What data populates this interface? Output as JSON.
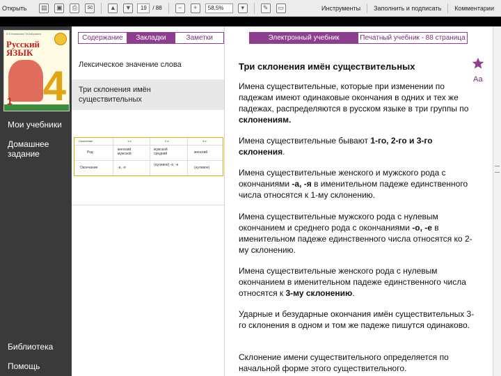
{
  "toolbar": {
    "open_label": "Открыть",
    "page_current": "19",
    "page_total": "/ 88",
    "zoom_value": "58,5%",
    "tools_label": "Инструменты",
    "fill_sign_label": "Заполнить и подписать",
    "comments_label": "Комментарии"
  },
  "book": {
    "authors": "Л.Ф.Климанова  Т.В.Бабушкина",
    "title_line1": "Русский",
    "title_line2": "язык",
    "grade": "4",
    "part": "1"
  },
  "sidebar": {
    "items": [
      {
        "label": "Мои учебники"
      },
      {
        "label": "Домашнее задание"
      },
      {
        "label": "Библиотека"
      },
      {
        "label": "Помощь"
      }
    ]
  },
  "panel": {
    "tabs": [
      {
        "label": "Содержание"
      },
      {
        "label": "Закладки"
      },
      {
        "label": "Заметки"
      }
    ],
    "toc": [
      {
        "label": "Лексическое значение слова"
      },
      {
        "label": "Три склонения имён существительных"
      }
    ],
    "thumb": {
      "col_headers": [
        "Склонение",
        "1-е",
        "2-е",
        "3-е"
      ],
      "row1_label": "Род",
      "row1": [
        "женский мужской",
        "мужской средний",
        "женский"
      ],
      "row2_label": "Окончание",
      "row2": [
        "-а, -я",
        "(нулевое) -о, -е",
        "(нулевое)"
      ]
    }
  },
  "main": {
    "tabs": [
      {
        "label": "Электронный учебник"
      },
      {
        "label": "Печатный учебник - 88 страница"
      }
    ],
    "font_size_label": "Аа",
    "heading": "Три склонения имён существительных",
    "paragraphs": [
      {
        "pre": "Имена существительные, которые при изменении по падежам имеют одинаковые окончания в одних и тех же падежах, распределяются в русском языке в три группы по ",
        "bold": "склонениям.",
        "post": ""
      },
      {
        "pre": "Имена существительные бывают ",
        "bold": "1-го, 2-го и 3-го склонения",
        "post": "."
      },
      {
        "pre": "Имена существительные женского и мужского рода с окончаниями ",
        "bold": "-а, -я",
        "post": " в именительном падеже единственного числа относятся к 1-му склонению."
      },
      {
        "pre": "Имена существительные мужского рода с нулевым окончанием и среднего рода с окончаниями ",
        "bold": "-о, -е",
        "post": " в именительном падеже единственного числа относятся ко 2-му склонению."
      },
      {
        "pre": "Имена существительные женского рода с нулевым окончанием в именительном падеже единственного числа относятся к ",
        "bold": "3-му склонению",
        "post": "."
      },
      {
        "pre": "Ударные и безударные окончания имён существительных 3-го склонения в одном и том же падеже пишутся одинаково.",
        "bold": "",
        "post": ""
      },
      {
        "pre": "Склонение имени существительного определяется по начальной форме этого существительного.",
        "bold": "",
        "post": ""
      }
    ]
  },
  "colors": {
    "accent": "#8e3e8e",
    "sidebar_bg": "#3a3a3a"
  }
}
